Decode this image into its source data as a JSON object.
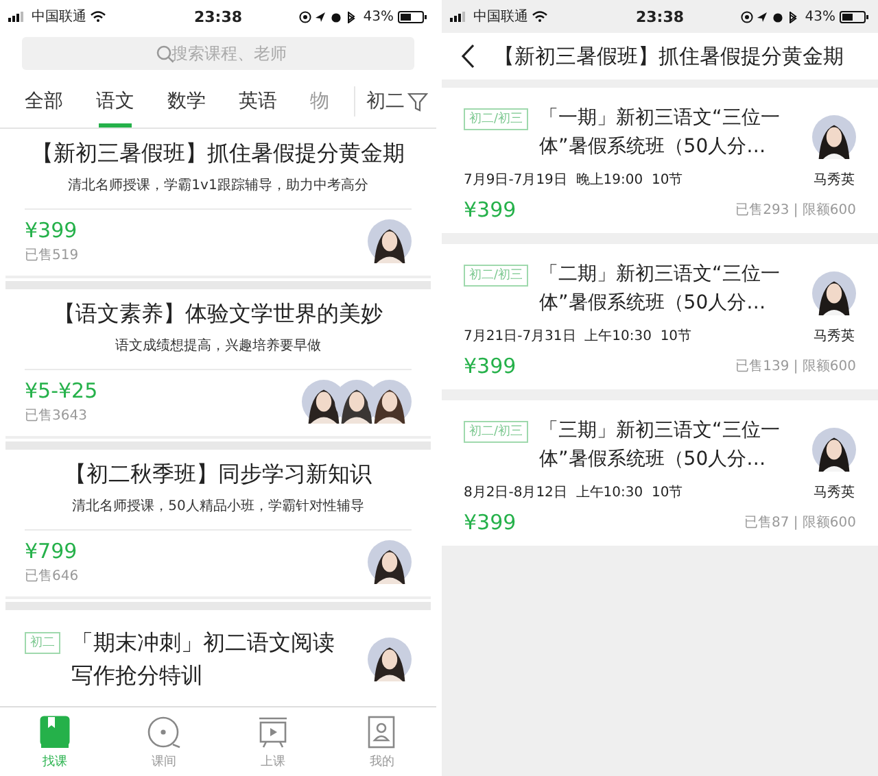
{
  "screens": [
    {
      "status_bar": {
        "carrier": "中国联通",
        "time": "23:38",
        "battery": "43%"
      },
      "search": {
        "placeholder": "搜索课程、老师"
      },
      "tabs": [
        {
          "label": "全部",
          "selected": false
        },
        {
          "label": "语文",
          "selected": true
        },
        {
          "label": "数学",
          "selected": false
        },
        {
          "label": "英语",
          "selected": false
        },
        {
          "label": "物",
          "selected": false
        }
      ],
      "grade_filter": "初二",
      "courses": [
        {
          "title": "【新初三暑假班】抓住暑假提分黄金期",
          "subtitle": "清北名师授课，学霸1v1跟踪辅导，助力中考高分",
          "price": "¥399",
          "sold": "已售519"
        },
        {
          "title": "【语文素养】体验文学世界的美妙",
          "subtitle": "语文成绩想提高，兴趣培养要早做",
          "price": "¥5-¥25",
          "sold": "已售3643"
        },
        {
          "title": "【初二秋季班】同步学习新知识",
          "subtitle": "清北名师授课，50人精品小班，学霸针对性辅导",
          "price": "¥799",
          "sold": "已售646"
        }
      ],
      "promo": {
        "tag": "初二",
        "title": "「期末冲刺」初二语文阅读写作抢分特训"
      },
      "bottom_nav": [
        {
          "label": "找课",
          "selected": true
        },
        {
          "label": "课间",
          "selected": false
        },
        {
          "label": "上课",
          "selected": false
        },
        {
          "label": "我的",
          "selected": false
        }
      ]
    },
    {
      "status_bar": {
        "carrier": "中国联通",
        "time": "23:38",
        "battery": "43%"
      },
      "header": {
        "title": "【新初三暑假班】抓住暑假提分黄金期"
      },
      "sessions": [
        {
          "tag": "初二/初三",
          "title": "「一期」新初三语文“三位一体”暑假系统班（50人分…",
          "schedule": "7月9日-7月19日  晚上19:00  10节",
          "teacher": "马秀英",
          "price": "¥399",
          "sold": "已售293 | 限额600"
        },
        {
          "tag": "初二/初三",
          "title": "「二期」新初三语文“三位一体”暑假系统班（50人分…",
          "schedule": "7月21日-7月31日  上午10:30  10节",
          "teacher": "马秀英",
          "price": "¥399",
          "sold": "已售139 | 限额600"
        },
        {
          "tag": "初二/初三",
          "title": "「三期」新初三语文“三位一体”暑假系统班（50人分…",
          "schedule": "8月2日-8月12日  上午10:30  10节",
          "teacher": "马秀英",
          "price": "¥399",
          "sold": "已售87 | 限额600"
        }
      ]
    }
  ]
}
